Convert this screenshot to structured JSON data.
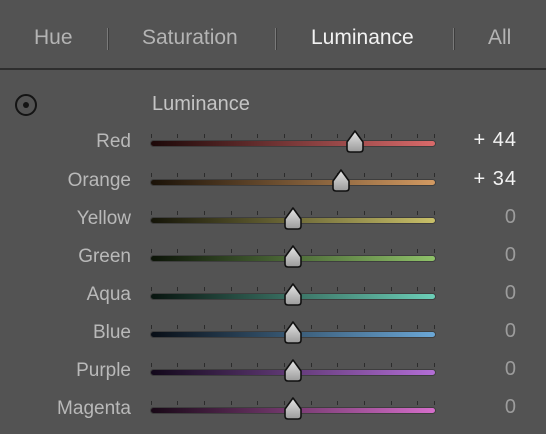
{
  "tabs": [
    {
      "label": "Hue",
      "active": false
    },
    {
      "label": "Saturation",
      "active": false
    },
    {
      "label": "Luminance",
      "active": true
    },
    {
      "label": "All",
      "active": false
    }
  ],
  "panel": {
    "title": "Luminance",
    "target_icon": "target-adjustment-icon"
  },
  "sliders": [
    {
      "label": "Red",
      "value": "+ 44",
      "amount": 44,
      "color_start": "#1c0808",
      "color_end": "#d96a6a"
    },
    {
      "label": "Orange",
      "value": "+ 34",
      "amount": 34,
      "color_start": "#1a1208",
      "color_end": "#d39a62"
    },
    {
      "label": "Yellow",
      "value": "0",
      "amount": 0,
      "color_start": "#141408",
      "color_end": "#c9c069"
    },
    {
      "label": "Green",
      "value": "0",
      "amount": 0,
      "color_start": "#0c1408",
      "color_end": "#8fc269"
    },
    {
      "label": "Aqua",
      "value": "0",
      "amount": 0,
      "color_start": "#08140f",
      "color_end": "#6ccfb8"
    },
    {
      "label": "Blue",
      "value": "0",
      "amount": 0,
      "color_start": "#080e16",
      "color_end": "#6ba7d6"
    },
    {
      "label": "Purple",
      "value": "0",
      "amount": 0,
      "color_start": "#12081a",
      "color_end": "#b36ed6"
    },
    {
      "label": "Magenta",
      "value": "0",
      "amount": 0,
      "color_start": "#180816",
      "color_end": "#d66ecb"
    }
  ]
}
